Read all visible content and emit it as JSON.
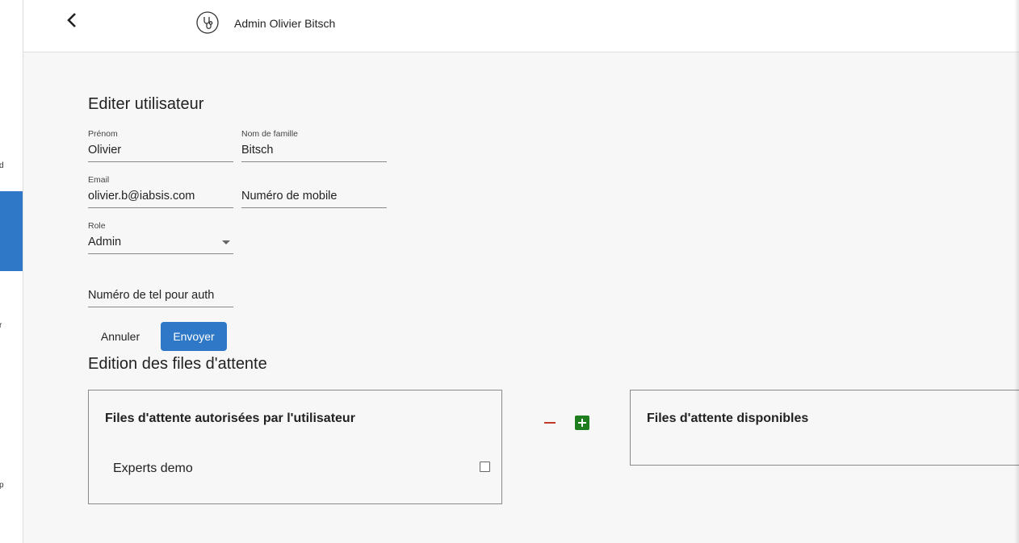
{
  "sidebar": {
    "items": [
      {
        "label": "d"
      },
      {
        "label": "r"
      },
      {
        "label": "p"
      }
    ],
    "active_color": "#2e78c7"
  },
  "header": {
    "user_title": "Admin Olivier Bitsch",
    "back_icon": "chevron-left-icon",
    "brand_icon": "stethoscope-icon"
  },
  "form": {
    "title": "Editer utilisateur",
    "first_name": {
      "label": "Prénom",
      "value": "Olivier"
    },
    "last_name": {
      "label": "Nom de famille",
      "value": "Bitsch"
    },
    "email": {
      "label": "Email",
      "value": "olivier.b@iabsis.com"
    },
    "mobile": {
      "placeholder": "Numéro de mobile"
    },
    "role": {
      "label": "Role",
      "value": "Admin"
    },
    "auth_phone": {
      "placeholder": "Numéro de tel pour auth"
    },
    "cancel_label": "Annuler",
    "submit_label": "Envoyer",
    "primary_color": "#2e78c7"
  },
  "queues": {
    "title": "Edition des files d'attente",
    "authorized": {
      "title": "Files d'attente autorisées par l'utilisateur",
      "items": [
        "Experts demo"
      ]
    },
    "available": {
      "title": "Files d'attente disponibles",
      "items": []
    },
    "remove_icon": "minus-icon",
    "add_icon": "plus-square-icon",
    "remove_color": "#c0392b",
    "add_color": "#1e7e1e"
  }
}
